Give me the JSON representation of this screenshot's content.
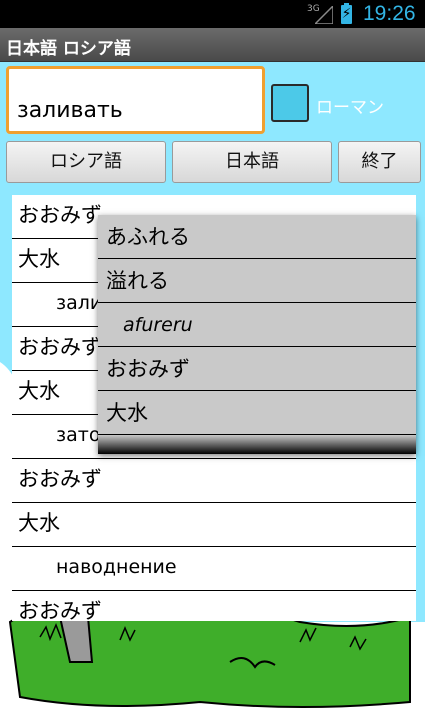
{
  "status_bar": {
    "network": "3G",
    "time": "19:26"
  },
  "title_bar": {
    "title": "日本語 ロシア語"
  },
  "search": {
    "value": "заливать"
  },
  "romaji_option": {
    "label": "ローマン",
    "checked": false
  },
  "buttons": {
    "russian": "ロシア語",
    "japanese": "日本語",
    "exit": "終了"
  },
  "results": [
    {
      "text": "おおみず",
      "indent": false
    },
    {
      "text": "大水",
      "indent": false
    },
    {
      "text": "заливать",
      "indent": true
    },
    {
      "text": "おおみず",
      "indent": false
    },
    {
      "text": "大水",
      "indent": false
    },
    {
      "text": "затопление",
      "indent": true
    },
    {
      "text": "おおみず",
      "indent": false
    },
    {
      "text": "大水",
      "indent": false
    },
    {
      "text": "наводнение",
      "indent": true
    },
    {
      "text": "おおみず",
      "indent": false
    }
  ],
  "popup": [
    {
      "text": "あふれる",
      "roman": false
    },
    {
      "text": "溢れる",
      "roman": false
    },
    {
      "text": "afureru",
      "roman": true
    },
    {
      "text": "おおみず",
      "roman": false
    },
    {
      "text": "大水",
      "roman": false
    }
  ],
  "colors": {
    "accent": "#33b5e5",
    "sky": "#8ee8ff",
    "grass": "#3fae2a",
    "focus": "#f0a030"
  }
}
